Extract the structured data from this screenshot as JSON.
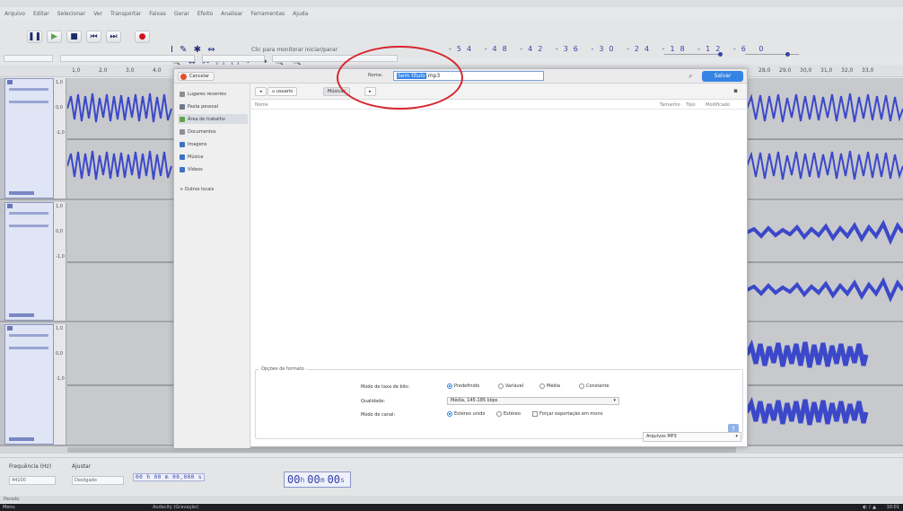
{
  "app": {
    "menu": [
      "Arquivo",
      "Editar",
      "Selecionar",
      "Ver",
      "Transportar",
      "Faixas",
      "Gerar",
      "Efeito",
      "Analisar",
      "Ferramentas",
      "Ajuda"
    ],
    "playback_device_hint": "Clic para monitorar iniciar/parar",
    "ruler_ticks": [
      "1,0",
      "2,0",
      "3,0",
      "4,0",
      "28,0",
      "29,0",
      "30,0",
      "31,0",
      "32,0",
      "33,0"
    ],
    "track_name": "Gravação",
    "vruler_labels": [
      "1,0",
      "0,5",
      "0,0",
      "-0,5",
      "-1,0"
    ]
  },
  "selection_toolbar": {
    "rate_label": "Frequência (Hz)",
    "snap_label": "Ajustar",
    "rate_value": "44100",
    "snap_value": "Desligado",
    "selection_clock": "00 h 00 m 00,000 s",
    "time_hours": "00",
    "time_minutes": "00",
    "time_seconds": "00",
    "unit_h": "h",
    "unit_m": "m",
    "unit_s": "s"
  },
  "statusbar": {
    "text": "Parado."
  },
  "taskbar": {
    "start": "Menu",
    "task": "Audacity (Gravação)",
    "clock": "10:01"
  },
  "dialog": {
    "cancel_label": "Cancelar",
    "name_label": "Nome:",
    "name_selected": "Sem título",
    "name_rest": ".mp3",
    "save_label": "Salvar",
    "sidebar": [
      {
        "label": "Lugares recentes",
        "color": "#8c8f95"
      },
      {
        "label": "Pasta pessoal",
        "color": "#6c7a8b"
      },
      {
        "label": "Área de trabalho",
        "color": "#5fa34a"
      },
      {
        "label": "Documentos",
        "color": "#8c8f95"
      },
      {
        "label": "Imagens",
        "color": "#3c72c4"
      },
      {
        "label": "Música",
        "color": "#3c72c4"
      },
      {
        "label": "Vídeos",
        "color": "#3c72c4"
      },
      {
        "label": "+ Outros locais",
        "color": "#8c8f95"
      }
    ],
    "path": [
      "usuario",
      "Músicas"
    ],
    "columns": {
      "name": "Nome",
      "size": "Tamanho",
      "type": "Tipo",
      "modified": "Modificado"
    },
    "format_title": "Opções de formato",
    "bitrate_label": "Modo de taxa de bits:",
    "bitrate_options": [
      "Predefinido",
      "Variável",
      "Média",
      "Constante"
    ],
    "bitrate_selected": 0,
    "quality_label": "Qualidade:",
    "quality_value": "Média, 145-185 kbps",
    "channel_label": "Modo de canal:",
    "channel_options": [
      "Estéreo unido",
      "Estéreo",
      "Forçar exportação em mono"
    ],
    "channel_selected": 0,
    "filetype_value": "Arquivos MP3"
  }
}
